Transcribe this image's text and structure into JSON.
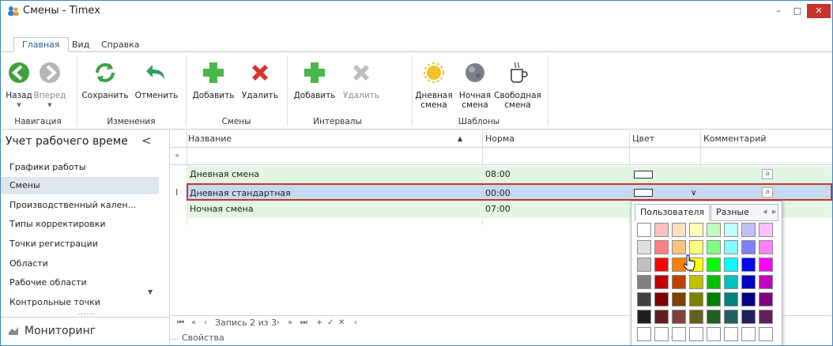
{
  "window": {
    "title": "Смены - Timex",
    "minimize": "–",
    "maximize": "□",
    "close": "✕"
  },
  "ribbon_tabs": [
    {
      "label": "Главная",
      "active": true
    },
    {
      "label": "Вид",
      "active": false
    },
    {
      "label": "Справка",
      "active": false
    }
  ],
  "ribbon": {
    "nav_back": "Назад",
    "nav_forward": "Вперед",
    "save": "Сохранить",
    "cancel": "Отменить",
    "shift_add": "Добавить",
    "shift_delete": "Удалить",
    "interval_add": "Добавить",
    "interval_delete": "Удалить",
    "day_shift": [
      "Дневная",
      "смена"
    ],
    "night_shift": [
      "Ночная",
      "смена"
    ],
    "free_shift": [
      "Свободная",
      "смена"
    ],
    "groups": {
      "navigation": "Навигация",
      "changes": "Изменения",
      "shifts": "Смены",
      "intervals": "Интервалы",
      "templates": "Шаблоны"
    }
  },
  "sidebar": {
    "header": "Учет рабочего време‌",
    "collapse": "<",
    "items": [
      {
        "label": "Графики работы",
        "selected": false
      },
      {
        "label": "Смены",
        "selected": true
      },
      {
        "label": "Производственный кален...",
        "selected": false
      },
      {
        "label": "Типы корректировки",
        "selected": false
      },
      {
        "label": "Точки регистрации",
        "selected": false
      },
      {
        "label": "Области",
        "selected": false
      },
      {
        "label": "Рабочие области",
        "selected": false
      },
      {
        "label": "Контрольные точки",
        "selected": false
      }
    ],
    "grip": "......",
    "more": "▼",
    "monitoring": "Мониторинг"
  },
  "grid": {
    "columns": {
      "name": "Название",
      "norm": "Норма",
      "color": "Цвет",
      "comment": "Комментарий"
    },
    "sort_indicator": "▲",
    "filter_icon": "ᵩ",
    "editing_indicator": "I",
    "rows": [
      {
        "name": "Дневная смена",
        "norm": "08:00",
        "memo": "a"
      },
      {
        "name": "Дневная стандартная",
        "norm": "00:00",
        "memo": "a"
      },
      {
        "name": "Ночная смена",
        "norm": "07:00",
        "memo": ""
      }
    ],
    "dropdown_arrow": "∨",
    "navigator": {
      "first": "⏮",
      "prev_page": "«",
      "prev": "‹",
      "record_text": "Запись 2 из 3",
      "next": "›",
      "next_page": "»",
      "last": "⏭",
      "add": "+",
      "apply": "✓",
      "remove": "✕",
      "more": "‹"
    },
    "properties_label": "Свойства"
  },
  "color_picker": {
    "tab_custom": "Пользователя",
    "tab_various": "Разные",
    "arrow_left": "◀",
    "arrow_right": "▶",
    "colors": [
      [
        "#ffffff",
        "#ffc0c0",
        "#ffe0c0",
        "#ffffc0",
        "#c0ffc0",
        "#c0ffff",
        "#c0c0ff",
        "#ffc0ff"
      ],
      [
        "#e0e0e0",
        "#ff8080",
        "#ffc080",
        "#ffff80",
        "#80ff80",
        "#80ffff",
        "#8080ff",
        "#ff80ff"
      ],
      [
        "#c0c0c0",
        "#ff0000",
        "#ff8000",
        "#ffff00",
        "#00ff00",
        "#00ffff",
        "#0000ff",
        "#ff00ff"
      ],
      [
        "#808080",
        "#c00000",
        "#c04000",
        "#c0c000",
        "#00c000",
        "#00c0c0",
        "#0000c0",
        "#c000c0"
      ],
      [
        "#404040",
        "#800000",
        "#804000",
        "#808000",
        "#008000",
        "#008080",
        "#000080",
        "#800080"
      ],
      [
        "#202020",
        "#602020",
        "#804040",
        "#606020",
        "#206020",
        "#206060",
        "#202060",
        "#602060"
      ],
      [
        "#ffffff",
        "#ffffff",
        "#ffffff",
        "#ffffff",
        "#ffffff",
        "#ffffff",
        "#ffffff",
        "#ffffff"
      ]
    ]
  }
}
